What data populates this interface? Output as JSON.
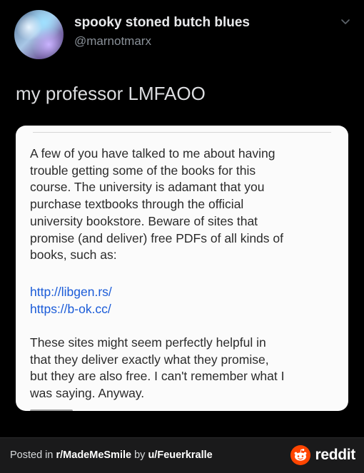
{
  "tweet": {
    "display_name": "spooky stoned butch blues",
    "handle": "@marnotmarx",
    "text": "my professor LMFAOO",
    "menu_icon": "chevron-down-icon",
    "avatar_icon": "avatar-image"
  },
  "card": {
    "paragraph1": "A few of you have talked to me about having\ntrouble getting some of the books for this\ncourse. The university is adamant that you\npurchase textbooks through the official\nuniversity bookstore. Beware of sites that\npromise (and deliver) free PDFs of all kinds of\nbooks, such as:",
    "links": [
      "http://libgen.rs/",
      "https://b-ok.cc/"
    ],
    "paragraph2": "These sites might seem perfectly helpful in\nthat they deliver exactly what they promise,\nbut they are also free. I can't remember what I\nwas saying. Anyway."
  },
  "footer": {
    "prefix": "Posted in ",
    "subreddit": "r/MadeMeSmile",
    "by": " by ",
    "user": "u/Feuerkralle",
    "brand": "reddit",
    "brand_icon": "reddit-snoo-icon",
    "brand_color": "#ff4500"
  }
}
